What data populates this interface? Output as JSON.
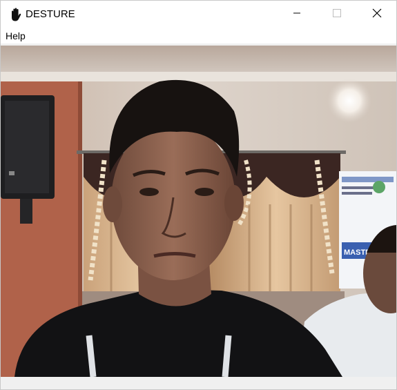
{
  "window": {
    "title": "DESTURE",
    "icon": "hand-icon",
    "controls": [
      "minimize-icon",
      "maximize-icon",
      "close-icon"
    ]
  },
  "menu": {
    "items": [
      {
        "label": "Help"
      }
    ]
  },
  "feed": {
    "description_icon": "camera-feed",
    "poster_text": [
      "MASTE"
    ]
  }
}
